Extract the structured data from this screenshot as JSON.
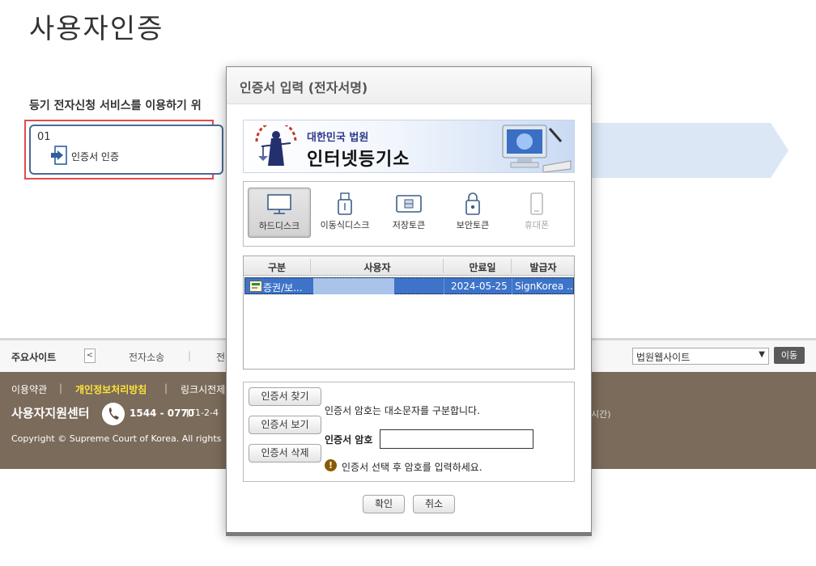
{
  "page": {
    "title": "사용자인증",
    "intro": "등기 전자신청 서비스를 이용하기 위",
    "step": {
      "number": "01",
      "label": "인증서 인증"
    }
  },
  "footer_bar": {
    "label": "주요사이트",
    "links": [
      "전자소송",
      "전"
    ],
    "select_value": "법원웹사이트",
    "go_label": "이동"
  },
  "footer": {
    "links": [
      "이용약관",
      "개인정보처리방침",
      "링크시전제"
    ],
    "center_title": "사용자지원센터",
    "phone": "1544 - 0770",
    "phone_extra": "[T1-2-4",
    "hours_tail": "시간)",
    "copyright": "Copyright © Supreme Court of Korea. All rights"
  },
  "dialog": {
    "title": "인증서 입력 (전자서명)",
    "banner": {
      "subtitle": "대한민국 법원",
      "main": "인터넷등기소"
    },
    "media": [
      {
        "label": "하드디스크",
        "icon": "monitor-icon",
        "state": "active"
      },
      {
        "label": "이동식디스크",
        "icon": "usb-icon",
        "state": "normal"
      },
      {
        "label": "저장토큰",
        "icon": "token-icon",
        "state": "normal"
      },
      {
        "label": "보안토큰",
        "icon": "lock-usb-icon",
        "state": "normal"
      },
      {
        "label": "휴대폰",
        "icon": "phone-icon",
        "state": "disabled"
      }
    ],
    "table": {
      "headers": [
        "구분",
        "사용자",
        "만료일",
        "발급자"
      ],
      "rows": [
        {
          "type": "증권/보...",
          "user": "",
          "expiry": "2024-05-25",
          "issuer": "SignKorea ..."
        }
      ]
    },
    "buttons": {
      "find": "인증서 찾기",
      "view": "인증서 보기",
      "delete": "인증서 삭제",
      "ok": "확인",
      "cancel": "취소"
    },
    "password": {
      "note": "인증서 암호는 대소문자를 구분합니다.",
      "label": "인증서 암호",
      "value": "",
      "hint": "인증서 선택 후 암호를 입력하세요."
    }
  },
  "colors": {
    "accent_red": "#e34b4b",
    "footer_bg": "#7b6b5a",
    "selected_row": "#3d74c9",
    "highlight_link": "#ffe23a"
  }
}
